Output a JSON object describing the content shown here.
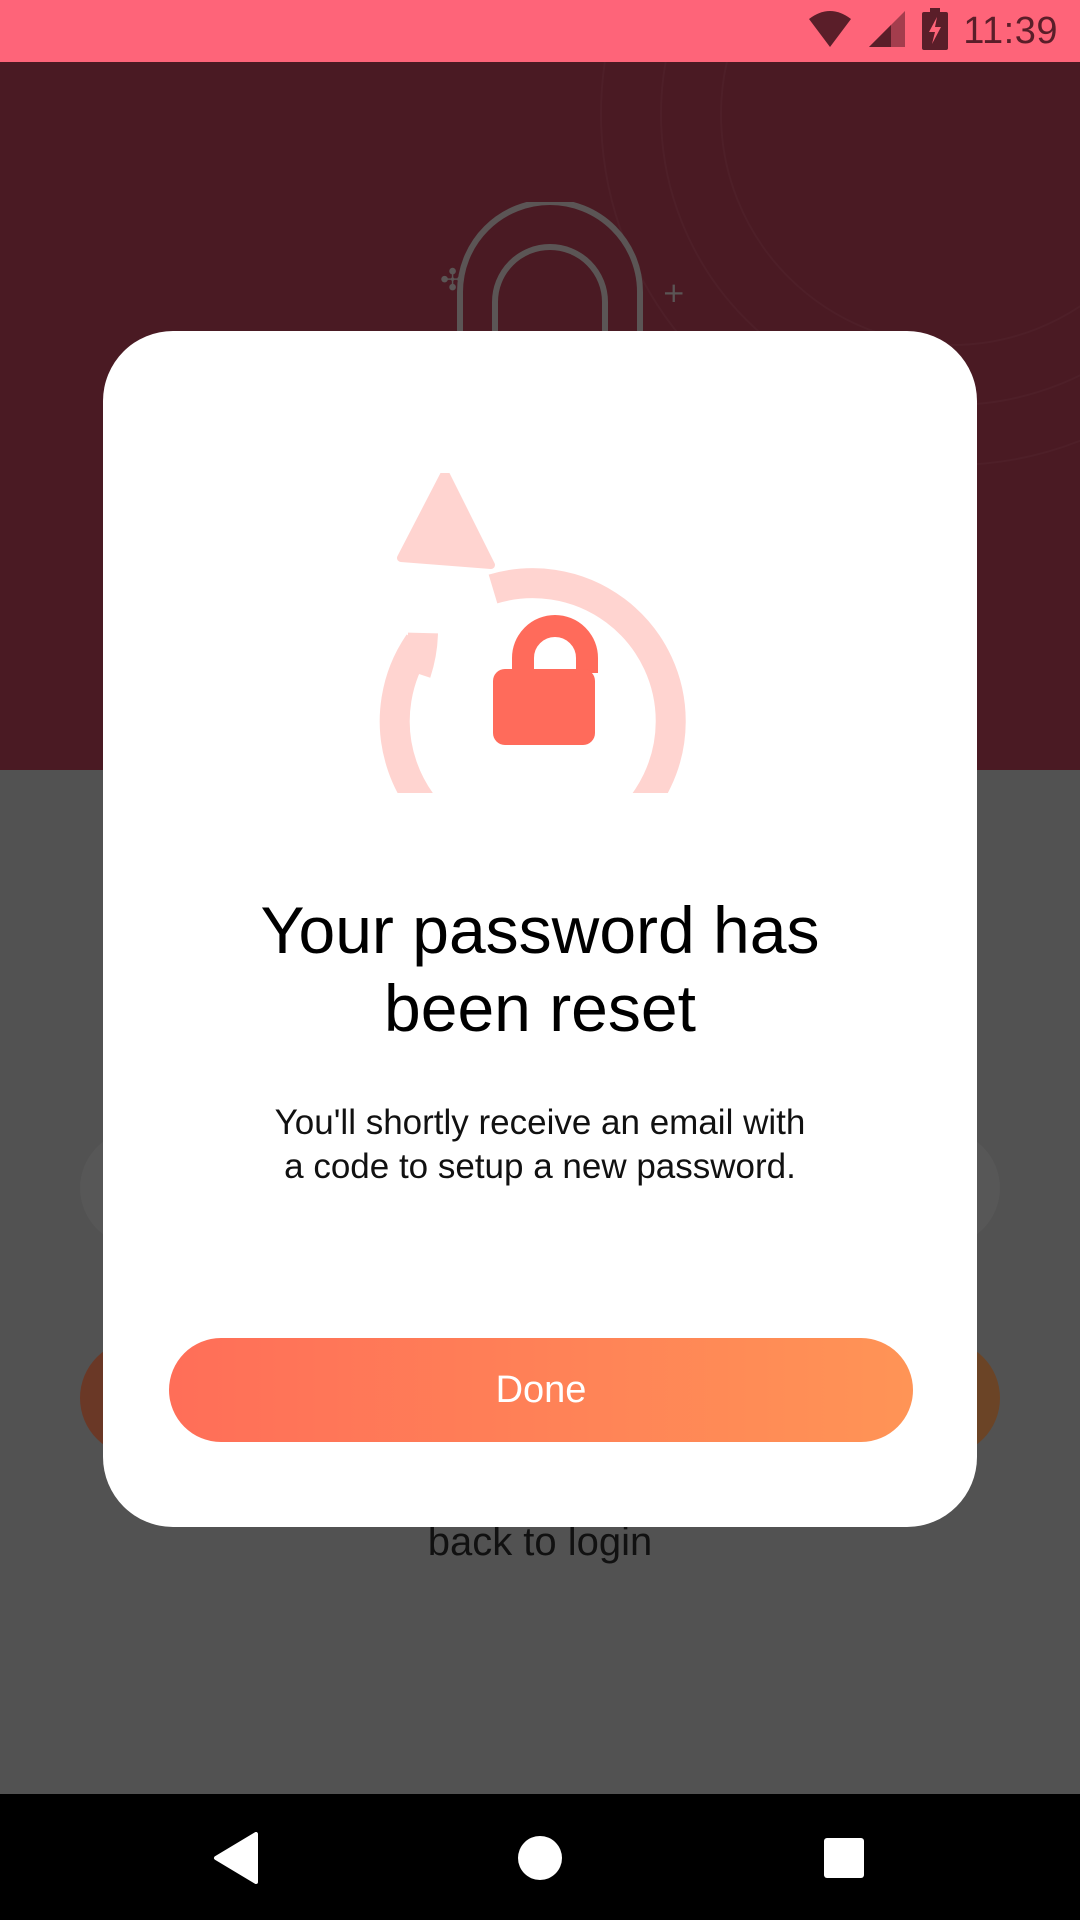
{
  "status_bar": {
    "time": "11:39",
    "icons": [
      "wifi-icon",
      "cell-signal-icon",
      "battery-charging-icon"
    ],
    "background_color": "#fe6479"
  },
  "background": {
    "back_to_login_label": "back to login"
  },
  "modal": {
    "title_line1": "Your password has",
    "title_line2": "been reset",
    "message_line1": "You'll shortly receive an email with",
    "message_line2": "a code to setup a new password.",
    "done_label": "Done",
    "illustration_icon": "lock-reset-icon",
    "accent_color": "#ff6b5b",
    "accent_light_color": "#ffd4d0",
    "button_gradient": [
      "#ff6e58",
      "#ff9456"
    ]
  },
  "nav_bar": {
    "buttons": [
      "back-icon",
      "home-icon",
      "recents-icon"
    ]
  }
}
